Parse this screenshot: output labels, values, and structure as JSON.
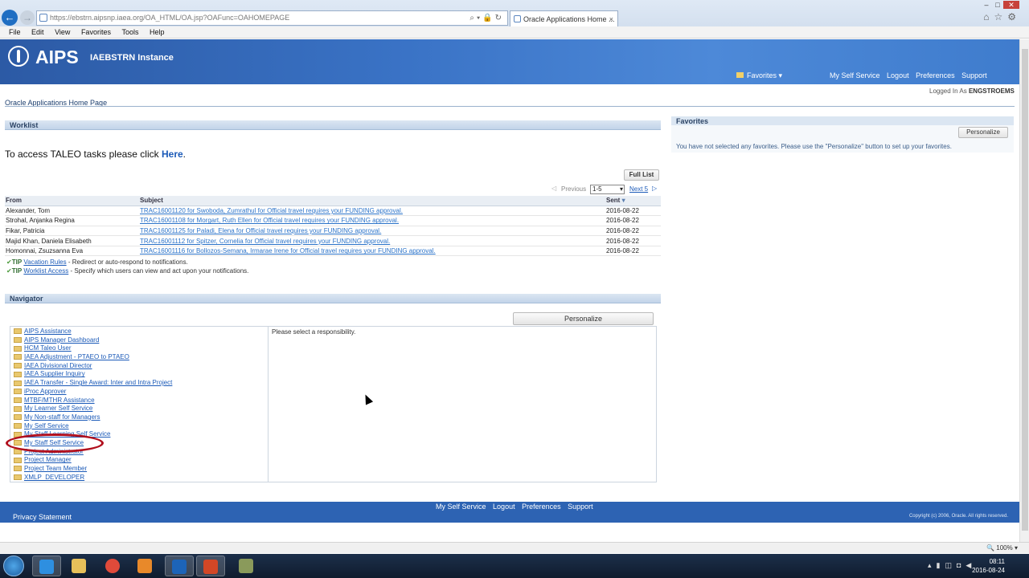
{
  "browser": {
    "address": "https://ebstrn.aipsnp.iaea.org/OA_HTML/OA.jsp?OAFunc=OAHOMEPAGE",
    "tab_title": "Oracle Applications Home ...",
    "tab_close": "×",
    "menu": [
      "File",
      "Edit",
      "View",
      "Favorites",
      "Tools",
      "Help"
    ],
    "zoom": "100%"
  },
  "header": {
    "logo_text": "AIPS",
    "instance": "IAEBSTRN Instance",
    "favorites_label": "Favorites",
    "global_links": [
      "My Self Service",
      "Logout",
      "Preferences",
      "Support"
    ],
    "logged_in_prefix": "Logged In As",
    "logged_in_user": "ENGSTROEMS"
  },
  "page_title": "Oracle Applications Home Page",
  "worklist": {
    "header": "Worklist",
    "taleo_text": "To access TALEO tasks please click",
    "taleo_link": "Here",
    "taleo_suffix": ".",
    "full_list": "Full List",
    "previous": "Previous",
    "range": "1-5",
    "next": "Next 5",
    "columns": [
      "From",
      "Subject",
      "Sent"
    ],
    "rows": [
      {
        "from": "Alexander, Tom",
        "subject": "TRAC16001120 for Swoboda, Zumrathul for Official travel requires your FUNDING approval.",
        "sent": "2016-08-22"
      },
      {
        "from": "Strohal, Anjanka Regina",
        "subject": "TRAC16001108 for Morgart, Ruth Ellen for Official travel requires your FUNDING approval.",
        "sent": "2016-08-22"
      },
      {
        "from": "Fikar, Patricia",
        "subject": "TRAC16001125 for Paladi, Elena for Official travel requires your FUNDING approval.",
        "sent": "2016-08-22"
      },
      {
        "from": "Majid Khan, Daniela Elisabeth",
        "subject": "TRAC16001112 for Spitzer, Cornelia for Official travel requires your FUNDING approval.",
        "sent": "2016-08-22"
      },
      {
        "from": "Homonnai, Zsuzsanna Eva",
        "subject": "TRAC16001116 for Bollozos-Semana, Irmarae Irene for Official travel requires your FUNDING approval.",
        "sent": "2016-08-22"
      }
    ],
    "tips": [
      {
        "tag": "TIP",
        "link": "Vacation Rules",
        "text": " - Redirect or auto-respond to notifications."
      },
      {
        "tag": "TIP",
        "link": "Worklist Access",
        "text": " - Specify which users can view and act upon your notifications."
      }
    ]
  },
  "navigator": {
    "header": "Navigator",
    "personalize": "Personalize",
    "message": "Please select a responsibility.",
    "items": [
      "AIPS Assistance",
      "AIPS Manager Dashboard",
      "HCM Taleo User",
      "IAEA Adjustment - PTAEO to PTAEO",
      "IAEA Divisional Director",
      "IAEA Supplier Inquiry",
      "IAEA Transfer - Single Award: Inter and Intra Project",
      "iProc Approver",
      "MTBF/MTHR Assistance",
      "My Learner Self Service",
      "My Non-staff for Managers",
      "My Self Service",
      "My Staff Learning Self Service",
      "My Staff Self Service",
      "Project Administrator",
      "Project Manager",
      "Project Team Member",
      "XMLP_DEVELOPER"
    ]
  },
  "favorites": {
    "header": "Favorites",
    "personalize": "Personalize",
    "message": "You have not selected any favorites. Please use the \"Personalize\" button to set up your favorites."
  },
  "footer": {
    "privacy": "Privacy Statement",
    "links": [
      "My Self Service",
      "Logout",
      "Preferences",
      "Support"
    ],
    "copyright": "Copyright (c) 2006, Oracle. All rights reserved."
  },
  "taskbar": {
    "time": "08:11",
    "date": "2016-08-24"
  }
}
